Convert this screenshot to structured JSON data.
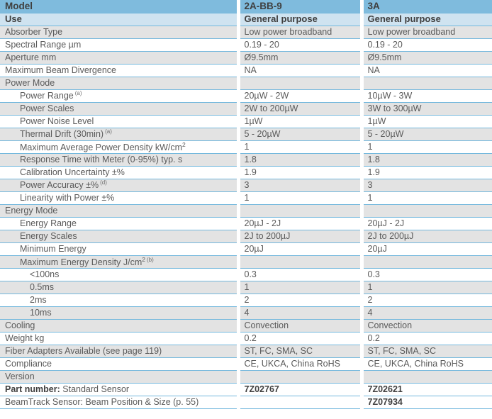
{
  "table": {
    "columns": [
      {
        "key": "label",
        "header": "Model"
      },
      {
        "key": "col1",
        "header": "2A-BB-9"
      },
      {
        "key": "col2",
        "header": "3A"
      }
    ],
    "use_row": {
      "label": "Use",
      "col1": "General purpose",
      "col2": "General purpose"
    },
    "rows": [
      {
        "label": "Absorber Type",
        "col1": "Low power broadband",
        "col2": "Low power broadband",
        "indent": 0,
        "stripe": true
      },
      {
        "label": "Spectral Range µm",
        "col1": "0.19 - 20",
        "col2": "0.19 - 20",
        "indent": 0,
        "stripe": false
      },
      {
        "label": "Aperture mm",
        "col1": "Ø9.5mm",
        "col2": "Ø9.5mm",
        "indent": 0,
        "stripe": true
      },
      {
        "label": "Maximum Beam Divergence",
        "col1": "NA",
        "col2": "NA",
        "indent": 0,
        "stripe": false
      },
      {
        "label": "Power Mode",
        "col1": "",
        "col2": "",
        "indent": 0,
        "stripe": true,
        "section": true
      },
      {
        "label": "Power Range",
        "footnote": "(a)",
        "col1": "20µW - 2W",
        "col2": "10µW - 3W",
        "indent": 1,
        "stripe": false
      },
      {
        "label": "Power Scales",
        "col1": "2W to 200µW",
        "col2": "3W to 300µW",
        "indent": 1,
        "stripe": true
      },
      {
        "label": "Power Noise Level",
        "col1": "1µW",
        "col2": "1µW",
        "indent": 1,
        "stripe": false
      },
      {
        "label": "Thermal Drift (30min)",
        "footnote": "(a)",
        "col1": "5 - 20µW",
        "col2": "5 - 20µW",
        "indent": 1,
        "stripe": true
      },
      {
        "label": "Maximum Average Power Density kW/cm",
        "sup": "2",
        "col1": "1",
        "col2": "1",
        "indent": 1,
        "stripe": false
      },
      {
        "label": "Response Time with Meter (0-95%) typ. s",
        "col1": "1.8",
        "col2": "1.8",
        "indent": 1,
        "stripe": true
      },
      {
        "label": "Calibration Uncertainty ±%",
        "col1": "1.9",
        "col2": "1.9",
        "indent": 1,
        "stripe": false
      },
      {
        "label": "Power Accuracy ±%",
        "footnote": "(d)",
        "col1": "3",
        "col2": "3",
        "indent": 1,
        "stripe": true
      },
      {
        "label": "Linearity with Power ±%",
        "col1": "1",
        "col2": "1",
        "indent": 1,
        "stripe": false
      },
      {
        "label": "Energy Mode",
        "col1": "",
        "col2": "",
        "indent": 0,
        "stripe": true,
        "section": true
      },
      {
        "label": "Energy Range",
        "col1": "20µJ - 2J",
        "col2": "20µJ - 2J",
        "indent": 1,
        "stripe": false
      },
      {
        "label": "Energy Scales",
        "col1": "2J to 200µJ",
        "col2": "2J to 200µJ",
        "indent": 1,
        "stripe": true
      },
      {
        "label": "Minimum Energy",
        "col1": "20µJ",
        "col2": "20µJ",
        "indent": 1,
        "stripe": false
      },
      {
        "label": "Maximum Energy Density J/cm",
        "sup": "2",
        "footnote": "(b)",
        "col1": "",
        "col2": "",
        "indent": 1,
        "stripe": true
      },
      {
        "label": "<100ns",
        "col1": "0.3",
        "col2": "0.3",
        "indent": 2,
        "stripe": false
      },
      {
        "label": "0.5ms",
        "col1": "1",
        "col2": "1",
        "indent": 2,
        "stripe": true
      },
      {
        "label": "2ms",
        "col1": "2",
        "col2": "2",
        "indent": 2,
        "stripe": false
      },
      {
        "label": "10ms",
        "col1": "4",
        "col2": "4",
        "indent": 2,
        "stripe": true
      },
      {
        "label": "Cooling",
        "col1": "Convection",
        "col2": "Convection",
        "indent": 0,
        "stripe": true
      },
      {
        "label": "Weight kg",
        "col1": "0.2",
        "col2": "0.2",
        "indent": 0,
        "stripe": false
      },
      {
        "label": "Fiber Adapters Available (see page 119)",
        "col1": "ST, FC, SMA, SC",
        "col2": "ST, FC, SMA, SC",
        "indent": 0,
        "stripe": true
      },
      {
        "label": "Compliance",
        "col1": "CE, UKCA, China RoHS",
        "col2": "CE, UKCA, China RoHS",
        "indent": 0,
        "stripe": false
      },
      {
        "label": "Version",
        "col1": "",
        "col2": "",
        "indent": 0,
        "stripe": true,
        "section": true
      },
      {
        "label_bold": "Part number:",
        "label": " Standard Sensor",
        "col1": "7Z02767",
        "col2": "7Z02621",
        "indent": 0,
        "stripe": false,
        "bold_values": true
      },
      {
        "label": "BeamTrack Sensor: Beam Position & Size (p. 55)",
        "col1": "",
        "col2": "7Z07934",
        "indent": 0,
        "stripe": false,
        "bold_values": true
      }
    ]
  },
  "colors": {
    "header_model_bg": "#7fbbdd",
    "header_use_bg": "#cfe3f0",
    "stripe_bg": "#e3e3e3",
    "plain_bg": "#ffffff",
    "rule": "#74b8dd",
    "text": "#5a5a5a",
    "text_strong": "#3f3f3f"
  }
}
